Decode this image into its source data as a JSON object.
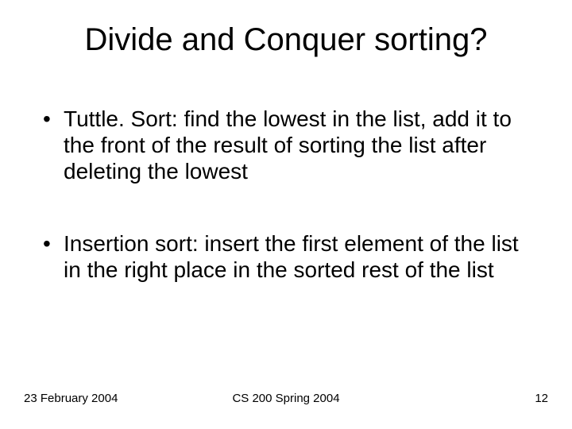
{
  "title": "Divide and Conquer sorting?",
  "bullets": [
    "Tuttle. Sort: find the lowest in the list, add it to the front of the result of sorting the list after deleting the lowest",
    "Insertion sort: insert the first element of the list in the right place in the sorted rest of the list"
  ],
  "footer": {
    "date": "23 February 2004",
    "course": "CS 200 Spring 2004",
    "page": "12"
  }
}
